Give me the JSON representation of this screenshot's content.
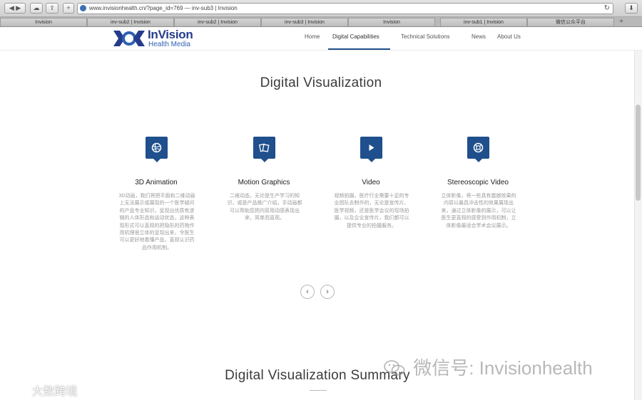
{
  "browser": {
    "url": "www.invisionhealth.cn/?page_id=769 — inv-sub3 | Invision",
    "tabs": [
      "Invision",
      "inv-sub2 | Invision",
      "inv-sub2 | Invision",
      "inv-sub3 | Invision",
      "inv-sub1 | Invision",
      "Invision",
      "inv-sub1 | Invision",
      "微信公众平台"
    ],
    "new_tab": "+"
  },
  "site": {
    "logo_name": "InVision",
    "logo_sub": "Health Media",
    "nav": [
      "Home",
      "Digital Capabilities",
      "Technical Solutions",
      "News",
      "About Us"
    ],
    "active_nav": "Digital Capabilities"
  },
  "main": {
    "title": "Digital Visualization",
    "features": [
      {
        "icon": "basketball-icon",
        "title": "3D Animation",
        "description": "3D动画，我们将把平面和二维动画上无法展示或展现的一个医学疑问的产品专业知识，呈现出优质有逻辑的人体形态和运动状态，这种表现形式可以直观的把隐形的药物作用机理很立体的呈现出来，令医生可以更好地看懂产品，直观认识药品作用机制。"
      },
      {
        "icon": "cards-icon",
        "title": "Motion Graphics",
        "description": "二维动态，无论是生产学习的知识，或是产品推广介绍，手动画都可以帮助您把内容用动感表现出来，简单而直观。"
      },
      {
        "icon": "play-icon",
        "title": "Video",
        "description": "视频拍摄，医疗行业需要十足的专业团队去制作的，无论是宣传片、医学视频，还是医学会议的现场拍摄，以及企业宣传片，我们都可以提供专业的拍摄服务。"
      },
      {
        "icon": "lifebuoy-icon",
        "title": "Stereoscopic Video",
        "description": "立体影像，将一些具有震撼效果的内容以最具冲击性的效果展现出来，通过立体影像的展示，可以让医生更直观的感受到作用机制，立体影像最适合学术会议展示。"
      }
    ],
    "carousel_prev": "‹",
    "carousel_next": "›",
    "summary_title": "Digital Visualization Summary"
  },
  "watermarks": {
    "right": "微信号: Invisionhealth",
    "left": "大数跨境"
  },
  "colors": {
    "brand": "#1f4f8c",
    "logo_text": "#243c8a"
  }
}
